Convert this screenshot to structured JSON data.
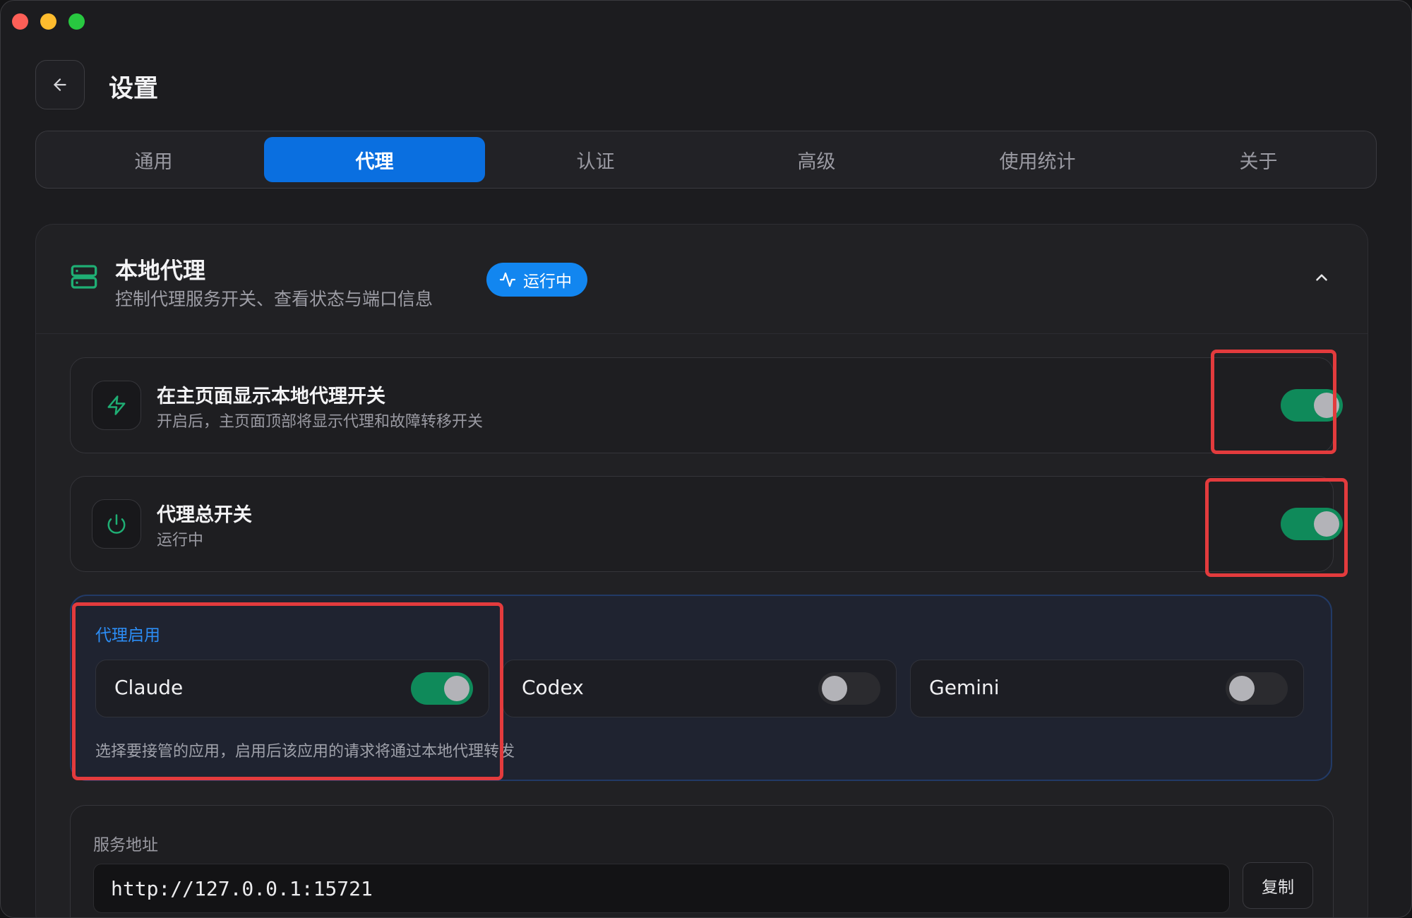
{
  "header": {
    "title": "设置"
  },
  "tabs": [
    {
      "label": "通用"
    },
    {
      "label": "代理",
      "active": true
    },
    {
      "label": "认证"
    },
    {
      "label": "高级"
    },
    {
      "label": "使用统计"
    },
    {
      "label": "关于"
    }
  ],
  "section": {
    "title": "本地代理",
    "subtitle": "控制代理服务开关、查看状态与端口信息",
    "status_badge": "运行中",
    "expanded": true
  },
  "settings": {
    "show_on_home": {
      "title": "在主页面显示本地代理开关",
      "description": "开启后，主页面顶部将显示代理和故障转移开关",
      "enabled": true,
      "icon": "lightning-icon"
    },
    "master_switch": {
      "title": "代理总开关",
      "description": "运行中",
      "enabled": true,
      "icon": "power-icon"
    }
  },
  "proxy_enable": {
    "label": "代理启用",
    "hint": "选择要接管的应用，启用后该应用的请求将通过本地代理转发",
    "apps": [
      {
        "name": "Claude",
        "enabled": true
      },
      {
        "name": "Codex",
        "enabled": false
      },
      {
        "name": "Gemini",
        "enabled": false
      }
    ]
  },
  "service_address": {
    "label": "服务地址",
    "value": "http://127.0.0.1:15721",
    "copy_label": "复制"
  },
  "colors": {
    "accent_blue": "#0a6fe0",
    "toggle_on": "#0f8a5a",
    "highlight_red": "#e33b3d",
    "icon_green": "#1fae74"
  }
}
